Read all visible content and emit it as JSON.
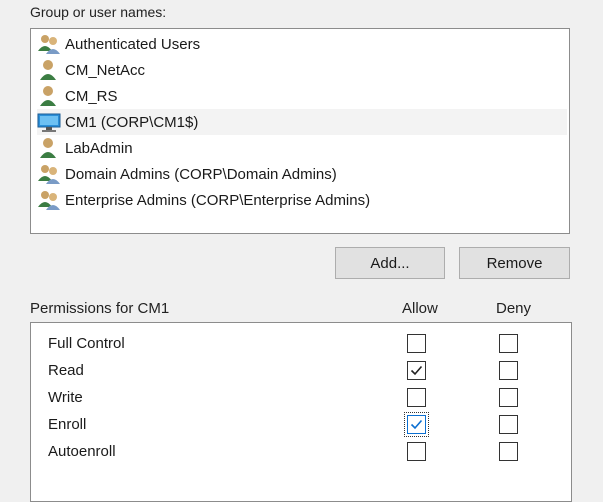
{
  "group_label": "Group or user names:",
  "users": [
    {
      "name": "Authenticated Users",
      "icon": "user-group-icon"
    },
    {
      "name": "CM_NetAcc",
      "icon": "user-icon"
    },
    {
      "name": "CM_RS",
      "icon": "user-icon"
    },
    {
      "name": "CM1 (CORP\\CM1$)",
      "icon": "computer-icon",
      "selected": true
    },
    {
      "name": "LabAdmin",
      "icon": "user-icon"
    },
    {
      "name": "Domain Admins (CORP\\Domain Admins)",
      "icon": "user-group-icon"
    },
    {
      "name": "Enterprise Admins (CORP\\Enterprise Admins)",
      "icon": "user-group-icon"
    }
  ],
  "buttons": {
    "add": "Add...",
    "remove": "Remove"
  },
  "permissions": {
    "title": "Permissions for CM1",
    "allow_header": "Allow",
    "deny_header": "Deny",
    "rows": [
      {
        "name": "Full Control",
        "allow": false,
        "deny": false
      },
      {
        "name": "Read",
        "allow": true,
        "deny": false
      },
      {
        "name": "Write",
        "allow": false,
        "deny": false
      },
      {
        "name": "Enroll",
        "allow": true,
        "deny": false,
        "focused": true
      },
      {
        "name": "Autoenroll",
        "allow": false,
        "deny": false
      }
    ]
  },
  "colors": {
    "selected_row": "#f3f3f3",
    "focus_border": "#0b6fd1",
    "computer_icon": "#2a8fd8"
  }
}
